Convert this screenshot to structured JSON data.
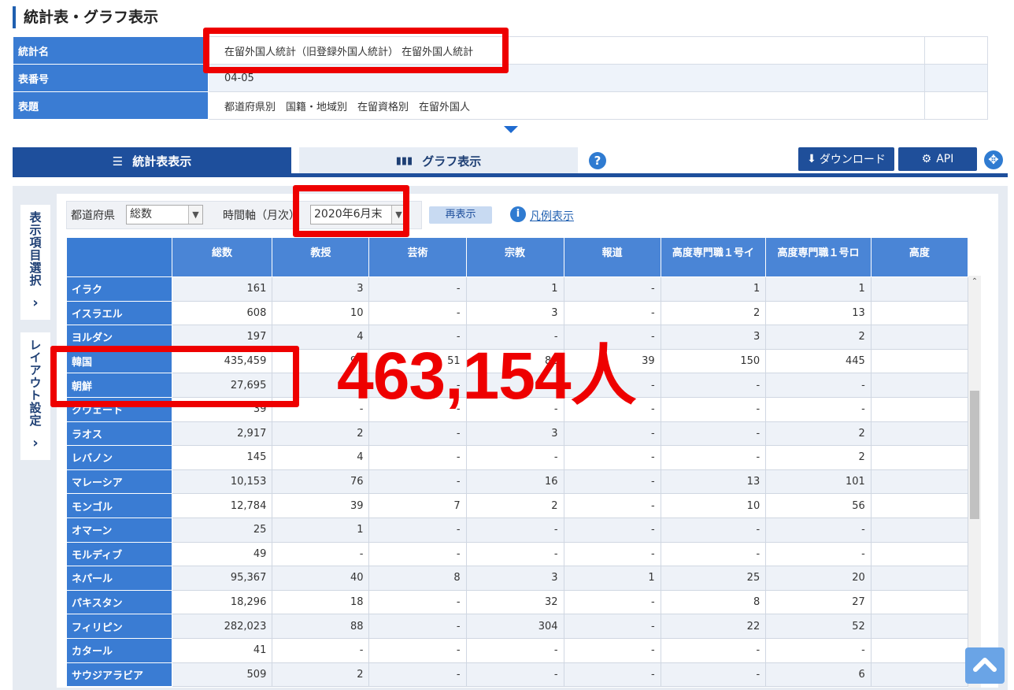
{
  "page_title": "統計表・グラフ表示",
  "info": {
    "rows": [
      {
        "label": "統計名",
        "value": "在留外国人統計（旧登録外国人統計） 在留外国人統計"
      },
      {
        "label": "表番号",
        "value": "04-05"
      },
      {
        "label": "表題",
        "value": "都道府県別　国籍・地域別　在留資格別　在留外国人"
      }
    ]
  },
  "tabs": {
    "table_view": "統計表表示",
    "graph_view": "グラフ表示",
    "help": "?",
    "download": "ダウンロード",
    "api": "API"
  },
  "side_tabs": {
    "items_select": "表示項目選択",
    "layout": "レイアウト設定"
  },
  "filters": {
    "prefecture_label": "都道府県",
    "prefecture_value": "総数",
    "time_label": "時間軸（月次）",
    "time_value": "2020年6月末",
    "refresh": "再表示",
    "legend": "凡例表示"
  },
  "grid": {
    "columns": [
      "総数",
      "教授",
      "芸術",
      "宗教",
      "報道",
      "高度専門職１号イ",
      "高度専門職１号ロ",
      "高度"
    ],
    "rows": [
      {
        "name": "イラク",
        "values": [
          "161",
          "3",
          "-",
          "1",
          "-",
          "1",
          "1"
        ]
      },
      {
        "name": "イスラエル",
        "values": [
          "608",
          "10",
          "-",
          "3",
          "-",
          "2",
          "13"
        ]
      },
      {
        "name": "ヨルダン",
        "values": [
          "197",
          "4",
          "-",
          "-",
          "-",
          "3",
          "2"
        ]
      },
      {
        "name": "韓国",
        "values": [
          "435,459",
          "97",
          "51",
          "81",
          "39",
          "150",
          "445"
        ]
      },
      {
        "name": "朝鮮",
        "values": [
          "27,695",
          "-",
          "-",
          "-",
          "-",
          "-",
          "-"
        ]
      },
      {
        "name": "クウェート",
        "values": [
          "39",
          "-",
          "-",
          "-",
          "-",
          "-",
          "-"
        ]
      },
      {
        "name": "ラオス",
        "values": [
          "2,917",
          "2",
          "-",
          "3",
          "-",
          "-",
          "2"
        ]
      },
      {
        "name": "レバノン",
        "values": [
          "145",
          "4",
          "-",
          "-",
          "-",
          "-",
          "2"
        ]
      },
      {
        "name": "マレーシア",
        "values": [
          "10,153",
          "76",
          "-",
          "16",
          "-",
          "13",
          "101"
        ]
      },
      {
        "name": "モンゴル",
        "values": [
          "12,784",
          "39",
          "7",
          "2",
          "-",
          "10",
          "56"
        ]
      },
      {
        "name": "オマーン",
        "values": [
          "25",
          "1",
          "-",
          "-",
          "-",
          "-",
          "-"
        ]
      },
      {
        "name": "モルディブ",
        "values": [
          "49",
          "-",
          "-",
          "-",
          "-",
          "-",
          "-"
        ]
      },
      {
        "name": "ネパール",
        "values": [
          "95,367",
          "40",
          "8",
          "3",
          "1",
          "25",
          "20"
        ]
      },
      {
        "name": "パキスタン",
        "values": [
          "18,296",
          "18",
          "-",
          "32",
          "-",
          "8",
          "27"
        ]
      },
      {
        "name": "フィリピン",
        "values": [
          "282,023",
          "88",
          "-",
          "304",
          "-",
          "22",
          "52"
        ]
      },
      {
        "name": "カタール",
        "values": [
          "41",
          "-",
          "-",
          "-",
          "-",
          "-",
          "-"
        ]
      },
      {
        "name": "サウジアラビア",
        "values": [
          "509",
          "2",
          "-",
          "-",
          "-",
          "-",
          "6"
        ]
      }
    ]
  },
  "annotation": {
    "total": "463,154人",
    "color": "#ee0000"
  }
}
